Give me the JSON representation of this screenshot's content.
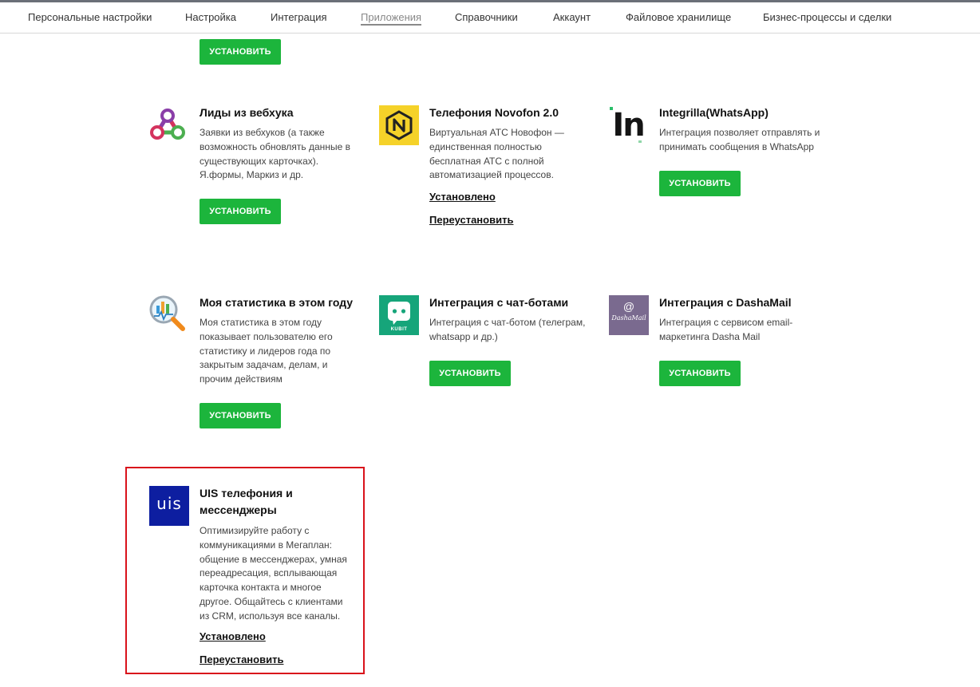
{
  "nav": {
    "tabs": [
      {
        "label": "Персональные настройки"
      },
      {
        "label": "Настройка"
      },
      {
        "label": "Интеграция"
      },
      {
        "label": "Приложения"
      },
      {
        "label": "Справочники"
      },
      {
        "label": "Аккаунт"
      },
      {
        "label": "Файловое хранилище"
      },
      {
        "label": "Бизнес-процессы и сделки"
      }
    ],
    "active_tab": "Приложения"
  },
  "labels": {
    "install": "УСТАНОВИТЬ",
    "installed": "Установлено",
    "reinstall": "Переустановить"
  },
  "apps": [
    {
      "title": "Лиды из вебхука",
      "description": "Заявки из вебхуков (а также возможность обновлять данные в существующих карточках). Я.формы, Маркиз и др.",
      "status": "not_installed",
      "icon": "webhook-icon"
    },
    {
      "title": "Телефония Novofon 2.0",
      "description": "Виртуальная АТС Новофон — единственная полностью бесплатная АТС с полной автоматизацией процессов.",
      "status": "installed",
      "icon": "novofon-icon"
    },
    {
      "title": "Integrilla(WhatsApp)",
      "description": "Интеграция позволяет отправлять и принимать сообщения в WhatsApp",
      "status": "not_installed",
      "icon": "integrilla-icon",
      "icon_text": "In"
    },
    {
      "title": "Моя статистика в этом году",
      "description": "Моя статистика в этом году показывает пользователю его статистику и лидеров года по закрытым задачам, делам, и прочим действиям",
      "status": "not_installed",
      "icon": "statistics-icon"
    },
    {
      "title": "Интеграция с чат-ботами",
      "description": "Интеграция с чат-ботом (телеграм, whatsapp и др.)",
      "status": "not_installed",
      "icon": "chatbot-icon",
      "icon_text": "KUBIT"
    },
    {
      "title": "Интеграция с DashaMail",
      "description": "Интеграция с сервисом email-маркетинга Dasha Mail",
      "status": "not_installed",
      "icon": "dashamail-icon",
      "icon_text": "DashaMail"
    },
    {
      "title": "UIS телефония и мессенджеры",
      "description": "Оптимизируйте работу с коммуникациями в Мегаплан: общение в мессенджерах, умная переадресация, всплывающая карточка контакта и многое другое. Общайтесь с клиентами из CRM, используя все каналы.",
      "status": "installed",
      "icon": "uis-icon",
      "icon_text": "uis",
      "highlighted": true
    }
  ],
  "colors": {
    "install_button": "#1cb53c",
    "highlight_border": "#d9121b",
    "uis_brand": "#0d1ea0",
    "novofon_brand": "#f5d229",
    "chatbot_brand": "#16a57a",
    "dashamail_brand": "#7a6a8f"
  }
}
